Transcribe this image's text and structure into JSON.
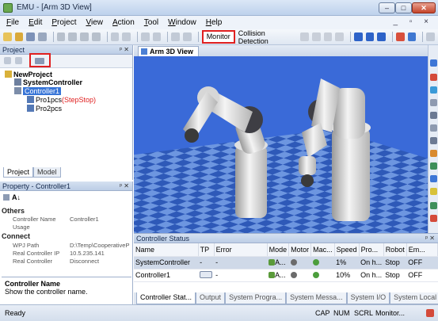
{
  "window": {
    "title": "EMU - [Arm 3D View]",
    "min": "–",
    "max": "□",
    "close": "✕"
  },
  "menu": [
    "File",
    "Edit",
    "Project",
    "View",
    "Action",
    "Tool",
    "Window",
    "Help"
  ],
  "mdi_controls": "_ ▫ ×",
  "toolbar": {
    "monitor_label": "Monitor",
    "collision_label": "Collision Detection"
  },
  "project_panel": {
    "title": "Project",
    "pin": "ᵖ ✕",
    "tree": {
      "root": "NewProject",
      "system_controller": "SystemController",
      "controller": "Controller1",
      "program1": "Pro1pcs",
      "program1_status": "(StepStop)",
      "program2": "Pro2pcs"
    },
    "tabs": [
      "Project",
      "Model"
    ]
  },
  "property_panel": {
    "title": "Property - Controller1",
    "pin": "ᵖ ✕",
    "toolbar_sort": "A↓",
    "categories": [
      {
        "name": "Others",
        "rows": [
          {
            "key": "Controller Name",
            "value": "Controller1"
          },
          {
            "key": "Usage",
            "value": ""
          }
        ]
      },
      {
        "name": "Connect",
        "rows": [
          {
            "key": "WPJ Path",
            "value": "D:\\Temp\\CooperativeP"
          },
          {
            "key": "Real Controller IP",
            "value": "10.5.235.141"
          },
          {
            "key": "Real Controller",
            "value": "Disconnect"
          }
        ]
      }
    ],
    "description_title": "Controller Name",
    "description_text": "Show the controller name."
  },
  "view_tab": "Arm 3D View",
  "controller_status": {
    "title": "Controller Status",
    "pin": "ᵖ ✕",
    "columns": [
      "Name",
      "TP",
      "Error",
      "Mode",
      "Motor",
      "Mac...",
      "Speed",
      "Pro...",
      "Robot",
      "Em..."
    ],
    "rows": [
      {
        "name": "SystemController",
        "tp": "-",
        "error": "-",
        "mode": "A...",
        "motor": "",
        "mac": "",
        "speed": "1%",
        "pro": "On h...",
        "robot": "Stop",
        "em": "OFF"
      },
      {
        "name": "Controller1",
        "tp": "",
        "error": "-",
        "mode": "A...",
        "motor": "",
        "mac": "",
        "speed": "10%",
        "pro": "On h...",
        "robot": "Stop",
        "em": "OFF"
      }
    ]
  },
  "bottom_tabs": [
    "Controller Stat...",
    "Output",
    "System Progra...",
    "System Messa...",
    "System I/O",
    "System Local ..."
  ],
  "statusbar": {
    "ready": "Ready",
    "cap": "CAP",
    "num": "NUM",
    "scrl": "SCRL",
    "monitor": "Monitor..."
  },
  "colors": {
    "floor_dark": "#2e59b8",
    "floor_light": "#6d96e0",
    "highlight": "#e02020",
    "selection": "#cfd9e8"
  }
}
